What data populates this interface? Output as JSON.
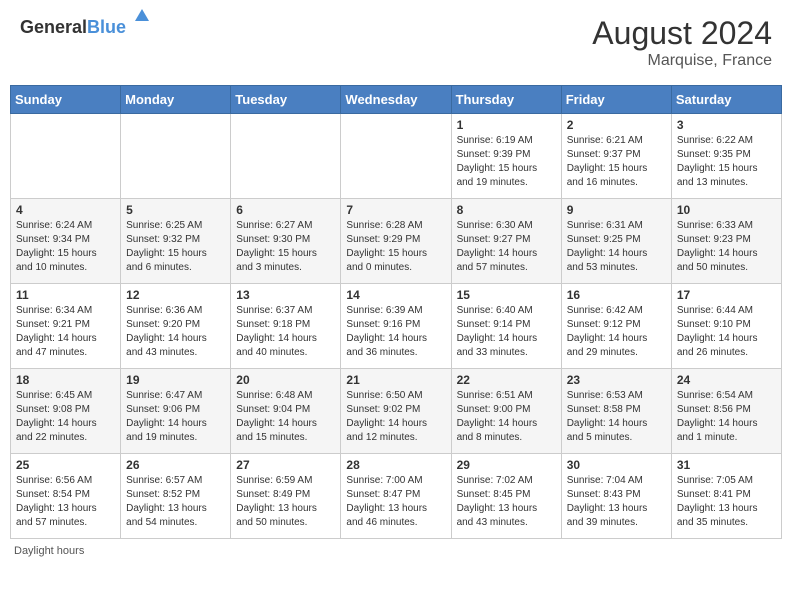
{
  "header": {
    "logo_general": "General",
    "logo_blue": "Blue",
    "month_year": "August 2024",
    "location": "Marquise, France"
  },
  "days_of_week": [
    "Sunday",
    "Monday",
    "Tuesday",
    "Wednesday",
    "Thursday",
    "Friday",
    "Saturday"
  ],
  "weeks": [
    [
      {
        "num": "",
        "info": ""
      },
      {
        "num": "",
        "info": ""
      },
      {
        "num": "",
        "info": ""
      },
      {
        "num": "",
        "info": ""
      },
      {
        "num": "1",
        "info": "Sunrise: 6:19 AM\nSunset: 9:39 PM\nDaylight: 15 hours and 19 minutes."
      },
      {
        "num": "2",
        "info": "Sunrise: 6:21 AM\nSunset: 9:37 PM\nDaylight: 15 hours and 16 minutes."
      },
      {
        "num": "3",
        "info": "Sunrise: 6:22 AM\nSunset: 9:35 PM\nDaylight: 15 hours and 13 minutes."
      }
    ],
    [
      {
        "num": "4",
        "info": "Sunrise: 6:24 AM\nSunset: 9:34 PM\nDaylight: 15 hours and 10 minutes."
      },
      {
        "num": "5",
        "info": "Sunrise: 6:25 AM\nSunset: 9:32 PM\nDaylight: 15 hours and 6 minutes."
      },
      {
        "num": "6",
        "info": "Sunrise: 6:27 AM\nSunset: 9:30 PM\nDaylight: 15 hours and 3 minutes."
      },
      {
        "num": "7",
        "info": "Sunrise: 6:28 AM\nSunset: 9:29 PM\nDaylight: 15 hours and 0 minutes."
      },
      {
        "num": "8",
        "info": "Sunrise: 6:30 AM\nSunset: 9:27 PM\nDaylight: 14 hours and 57 minutes."
      },
      {
        "num": "9",
        "info": "Sunrise: 6:31 AM\nSunset: 9:25 PM\nDaylight: 14 hours and 53 minutes."
      },
      {
        "num": "10",
        "info": "Sunrise: 6:33 AM\nSunset: 9:23 PM\nDaylight: 14 hours and 50 minutes."
      }
    ],
    [
      {
        "num": "11",
        "info": "Sunrise: 6:34 AM\nSunset: 9:21 PM\nDaylight: 14 hours and 47 minutes."
      },
      {
        "num": "12",
        "info": "Sunrise: 6:36 AM\nSunset: 9:20 PM\nDaylight: 14 hours and 43 minutes."
      },
      {
        "num": "13",
        "info": "Sunrise: 6:37 AM\nSunset: 9:18 PM\nDaylight: 14 hours and 40 minutes."
      },
      {
        "num": "14",
        "info": "Sunrise: 6:39 AM\nSunset: 9:16 PM\nDaylight: 14 hours and 36 minutes."
      },
      {
        "num": "15",
        "info": "Sunrise: 6:40 AM\nSunset: 9:14 PM\nDaylight: 14 hours and 33 minutes."
      },
      {
        "num": "16",
        "info": "Sunrise: 6:42 AM\nSunset: 9:12 PM\nDaylight: 14 hours and 29 minutes."
      },
      {
        "num": "17",
        "info": "Sunrise: 6:44 AM\nSunset: 9:10 PM\nDaylight: 14 hours and 26 minutes."
      }
    ],
    [
      {
        "num": "18",
        "info": "Sunrise: 6:45 AM\nSunset: 9:08 PM\nDaylight: 14 hours and 22 minutes."
      },
      {
        "num": "19",
        "info": "Sunrise: 6:47 AM\nSunset: 9:06 PM\nDaylight: 14 hours and 19 minutes."
      },
      {
        "num": "20",
        "info": "Sunrise: 6:48 AM\nSunset: 9:04 PM\nDaylight: 14 hours and 15 minutes."
      },
      {
        "num": "21",
        "info": "Sunrise: 6:50 AM\nSunset: 9:02 PM\nDaylight: 14 hours and 12 minutes."
      },
      {
        "num": "22",
        "info": "Sunrise: 6:51 AM\nSunset: 9:00 PM\nDaylight: 14 hours and 8 minutes."
      },
      {
        "num": "23",
        "info": "Sunrise: 6:53 AM\nSunset: 8:58 PM\nDaylight: 14 hours and 5 minutes."
      },
      {
        "num": "24",
        "info": "Sunrise: 6:54 AM\nSunset: 8:56 PM\nDaylight: 14 hours and 1 minute."
      }
    ],
    [
      {
        "num": "25",
        "info": "Sunrise: 6:56 AM\nSunset: 8:54 PM\nDaylight: 13 hours and 57 minutes."
      },
      {
        "num": "26",
        "info": "Sunrise: 6:57 AM\nSunset: 8:52 PM\nDaylight: 13 hours and 54 minutes."
      },
      {
        "num": "27",
        "info": "Sunrise: 6:59 AM\nSunset: 8:49 PM\nDaylight: 13 hours and 50 minutes."
      },
      {
        "num": "28",
        "info": "Sunrise: 7:00 AM\nSunset: 8:47 PM\nDaylight: 13 hours and 46 minutes."
      },
      {
        "num": "29",
        "info": "Sunrise: 7:02 AM\nSunset: 8:45 PM\nDaylight: 13 hours and 43 minutes."
      },
      {
        "num": "30",
        "info": "Sunrise: 7:04 AM\nSunset: 8:43 PM\nDaylight: 13 hours and 39 minutes."
      },
      {
        "num": "31",
        "info": "Sunrise: 7:05 AM\nSunset: 8:41 PM\nDaylight: 13 hours and 35 minutes."
      }
    ]
  ],
  "footer": {
    "note": "Daylight hours"
  }
}
